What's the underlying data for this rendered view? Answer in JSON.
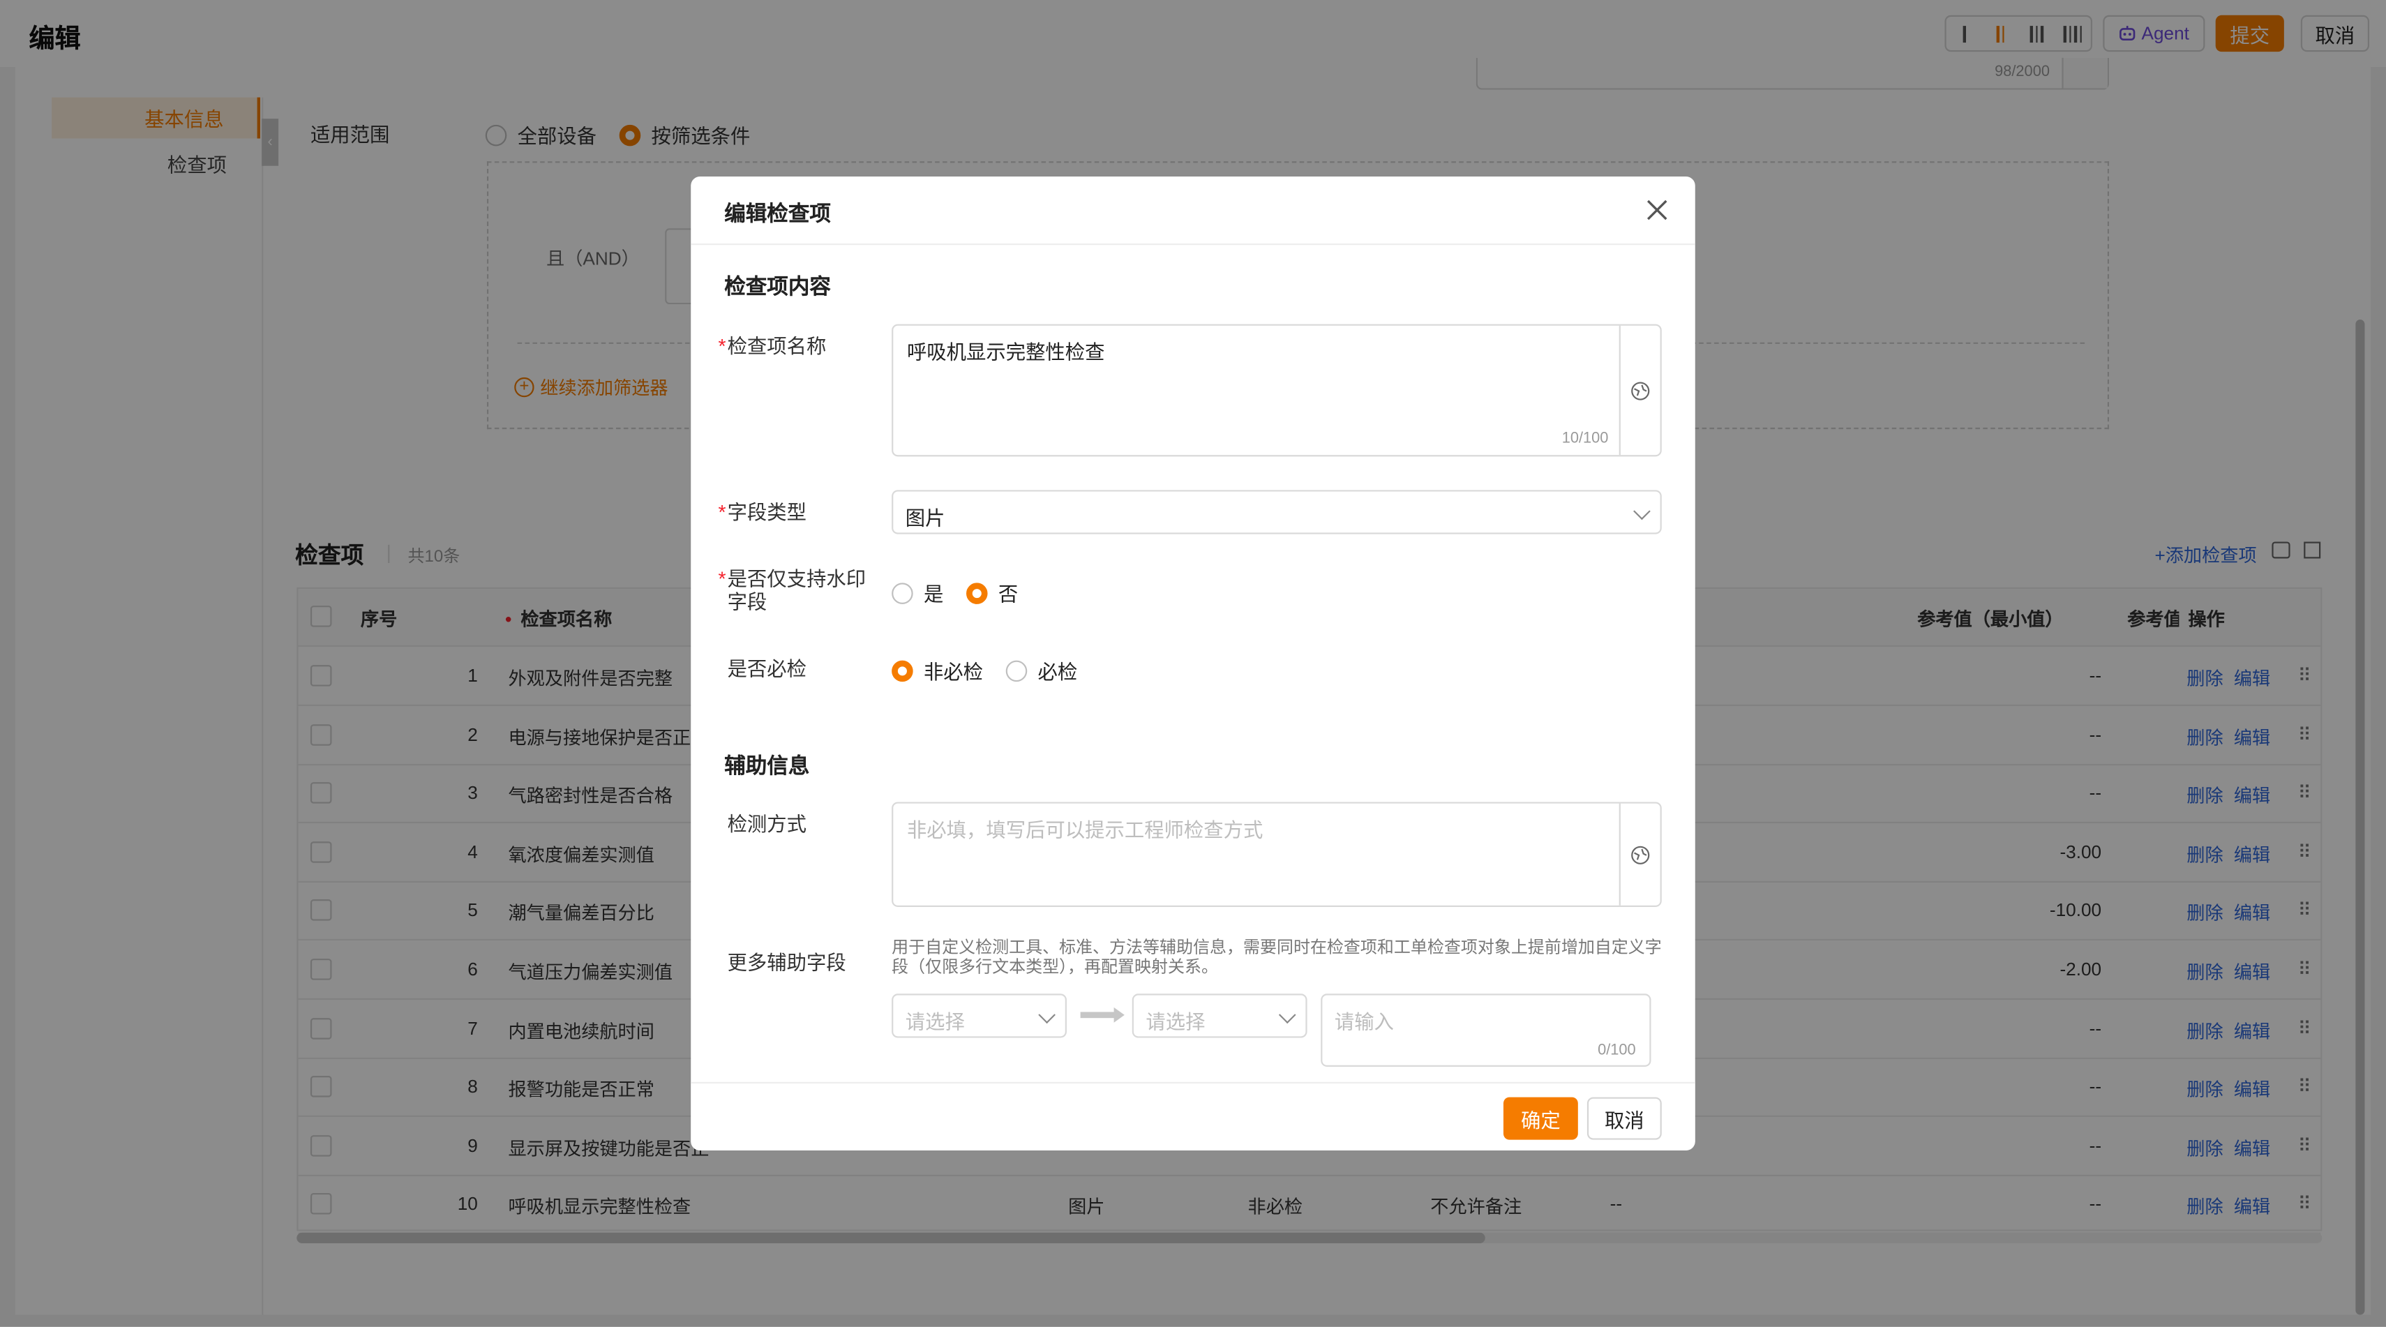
{
  "header": {
    "title": "编辑",
    "agent_label": "Agent",
    "submit_label": "提交",
    "cancel_label": "取消"
  },
  "left_nav": {
    "items": [
      "基本信息",
      "检查项"
    ]
  },
  "top_textarea": {
    "count": "98/2000"
  },
  "scope": {
    "label": "适用范围",
    "options": [
      "全部设备",
      "按筛选条件"
    ],
    "selected": "按筛选条件"
  },
  "filter": {
    "and_label": "且（AND）",
    "add_filter": "继续添加筛选器"
  },
  "items_section": {
    "title": "检查项",
    "count": "共10条",
    "add_link": "+添加检查项",
    "columns": {
      "index": "序号",
      "name": "检查项名称",
      "ref_min": "参考值（最小值）",
      "ref_max": "参考值",
      "ops": "操作"
    },
    "rows": [
      {
        "idx": "1",
        "name": "外观及附件是否完整",
        "min": "--"
      },
      {
        "idx": "2",
        "name": "电源与接地保护是否正",
        "min": "--"
      },
      {
        "idx": "3",
        "name": "气路密封性是否合格",
        "min": "--"
      },
      {
        "idx": "4",
        "name": "氧浓度偏差实测值",
        "min": "-3.00"
      },
      {
        "idx": "5",
        "name": "潮气量偏差百分比",
        "min": "-10.00"
      },
      {
        "idx": "6",
        "name": "气道压力偏差实测值",
        "min": "-2.00"
      },
      {
        "idx": "7",
        "name": "内置电池续航时间",
        "min": "--"
      },
      {
        "idx": "8",
        "name": "报警功能是否正常",
        "min": "--"
      },
      {
        "idx": "9",
        "name": "显示屏及按键功能是否正",
        "min": "--"
      },
      {
        "idx": "10",
        "name": "呼吸机显示完整性检查",
        "min": "--",
        "type": "图片",
        "required": "非必检",
        "remark": "不允许备注",
        "extra": "--"
      }
    ],
    "delete_label": "删除",
    "edit_label": "编辑"
  },
  "modal": {
    "title": "编辑检查项",
    "section_content": "检查项内容",
    "name_label": "检查项名称",
    "name_value": "呼吸机显示完整性检查",
    "name_count": "10/100",
    "field_type_label": "字段类型",
    "field_type_value": "图片",
    "watermark_label": "是否仅支持水印字段",
    "watermark_options": [
      "是",
      "否"
    ],
    "watermark_selected": "否",
    "required_label": "是否必检",
    "required_options": [
      "非必检",
      "必检"
    ],
    "required_selected": "非必检",
    "section_aux": "辅助信息",
    "method_label": "检测方式",
    "method_placeholder": "非必填，填写后可以提示工程师检查方式",
    "more_label": "更多辅助字段",
    "more_help": "用于自定义检测工具、标准、方法等辅助信息，需要同时在检查项和工单检查项对象上提前增加自定义字段（仅限多行文本类型），再配置映射关系。",
    "select_placeholder": "请选择",
    "input_placeholder": "请输入",
    "input_count": "0/100",
    "ok_label": "确定",
    "cancel_label": "取消"
  },
  "colors": {
    "accent": "#f57c00",
    "link": "#2f66d9",
    "required": "#f5222d"
  }
}
